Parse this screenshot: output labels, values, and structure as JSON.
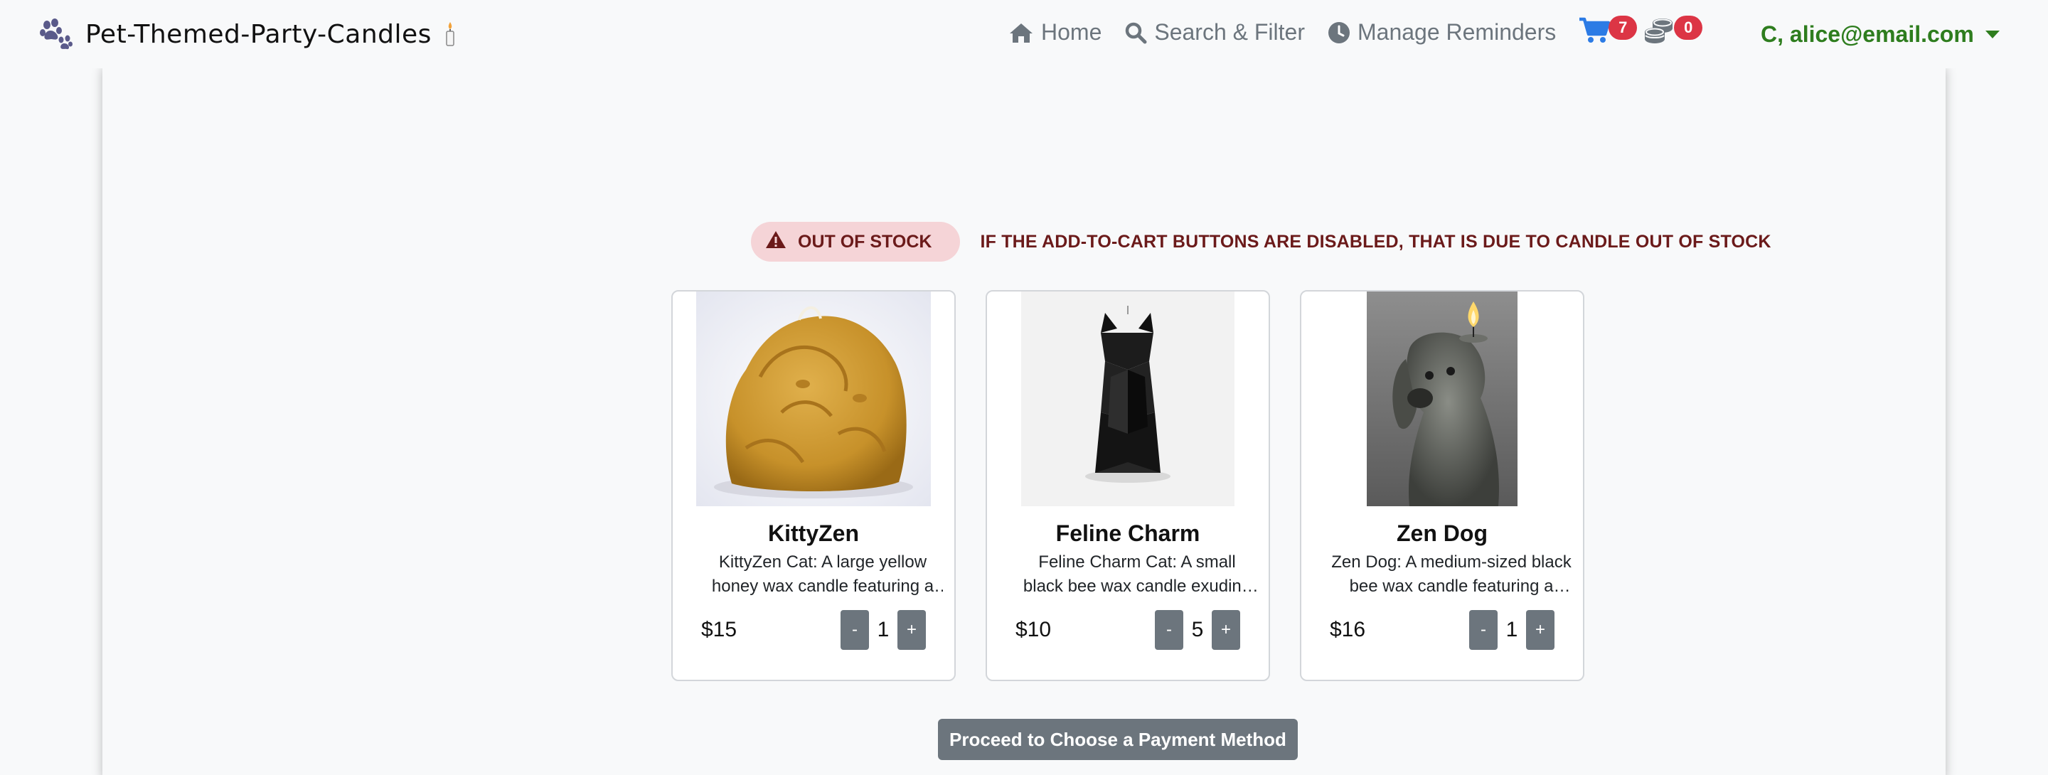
{
  "brand": {
    "name": "Pet-Themed-Party-Candles",
    "paw_icon": "paw-icon",
    "candle_icon": "candle-icon"
  },
  "nav": {
    "home": {
      "label": "Home",
      "icon": "home-icon"
    },
    "search": {
      "label": "Search & Filter",
      "icon": "search-icon"
    },
    "reminders": {
      "label": "Manage Reminders",
      "icon": "clock-icon"
    },
    "cart": {
      "icon": "cart-icon",
      "count": "7"
    },
    "coins": {
      "icon": "coins-icon",
      "count": "0"
    },
    "user": {
      "label": "C, alice@email.com"
    }
  },
  "notice": {
    "badge": "OUT OF STOCK",
    "text": "IF THE ADD-TO-CART BUTTONS ARE DISABLED, THAT IS DUE TO CANDLE OUT OF STOCK"
  },
  "products": [
    {
      "name": "KittyZen",
      "description": "KittyZen Cat: A large yellow honey wax candle featuring a cluster of sleeping kittens",
      "price": "$15",
      "quantity": "1",
      "minus_label": "-",
      "plus_label": "+"
    },
    {
      "name": "Feline Charm",
      "description": "Feline Charm Cat: A small black bee wax candle exuding the charm of a geometric cat",
      "price": "$10",
      "quantity": "5",
      "minus_label": "-",
      "plus_label": "+"
    },
    {
      "name": "Zen Dog",
      "description": "Zen Dog: A medium-sized black bee wax candle featuring a calm seated dog",
      "price": "$16",
      "quantity": "1",
      "minus_label": "-",
      "plus_label": "+"
    }
  ],
  "proceed_label": "Proceed to Choose a Payment Method",
  "colors": {
    "user_green": "#2e7d1e",
    "badge_red": "#dc3545",
    "cart_blue": "#2c7be5",
    "button_gray": "#6c757d",
    "warning_text": "#6b1a1a",
    "warning_bg": "#f5d4d7"
  }
}
